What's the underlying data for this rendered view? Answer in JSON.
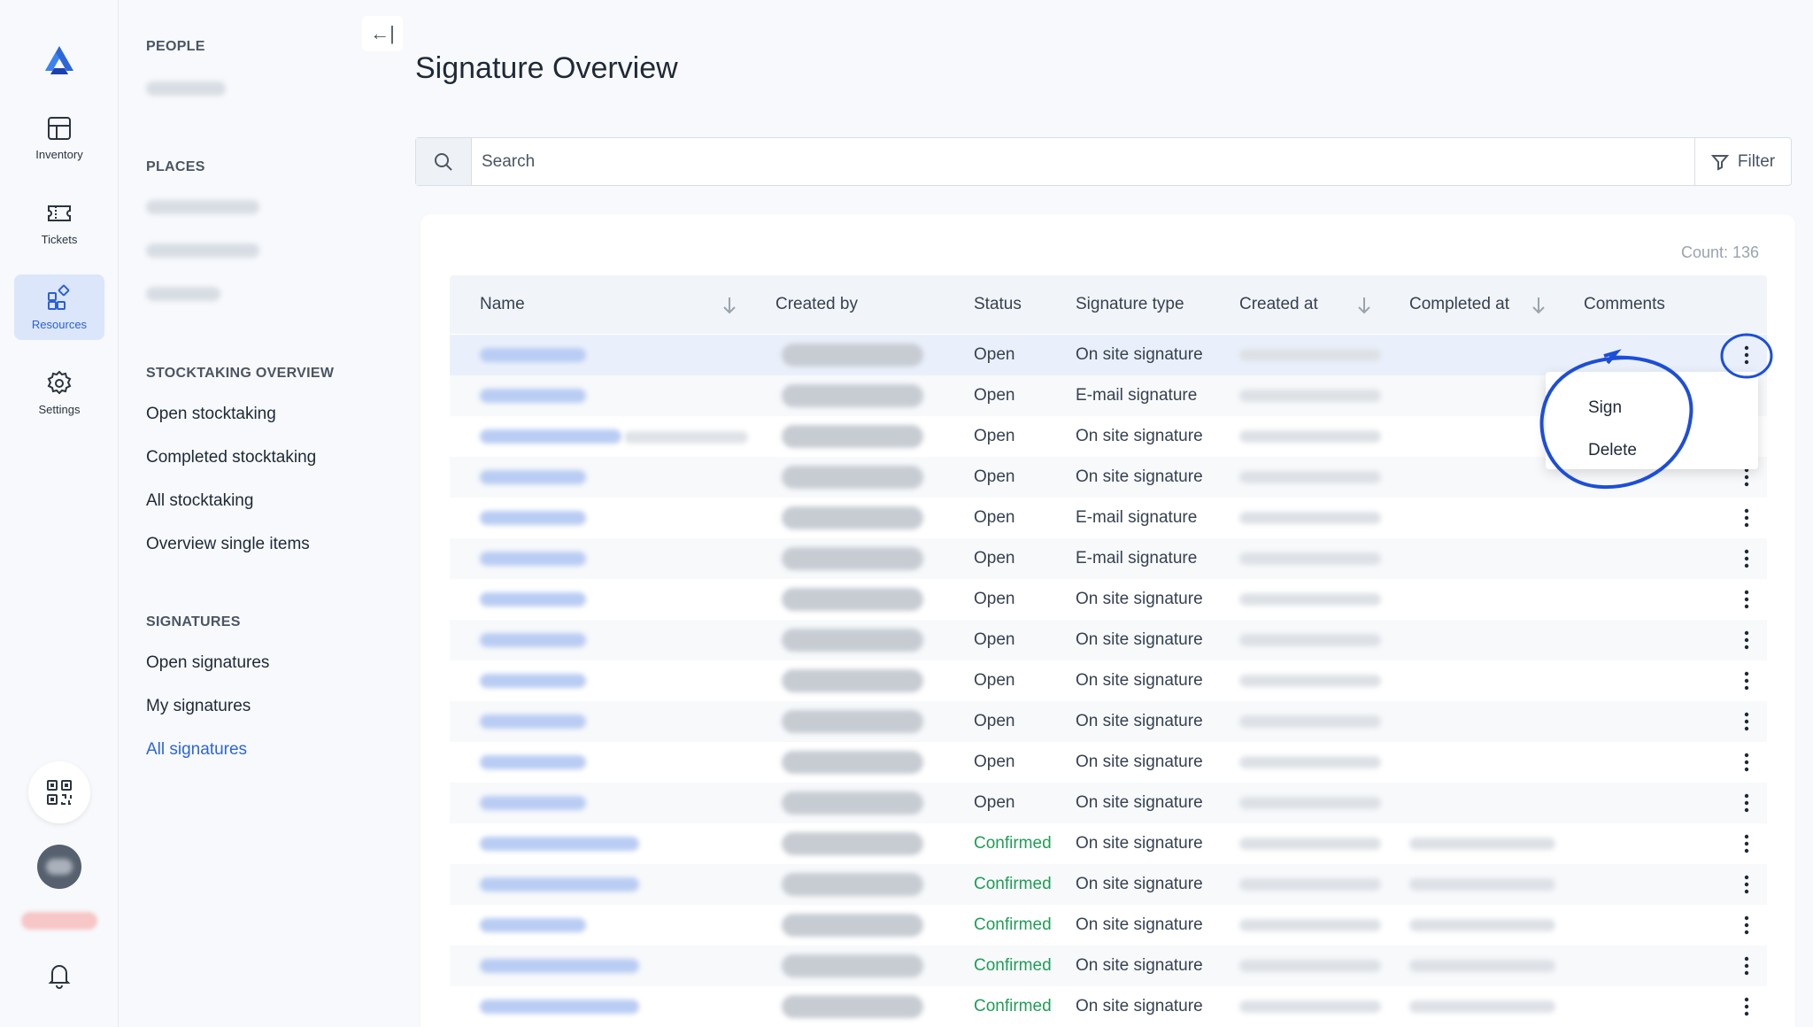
{
  "rail": {
    "items": [
      {
        "label": "Inventory",
        "icon": "inventory-icon"
      },
      {
        "label": "Tickets",
        "icon": "ticket-icon"
      },
      {
        "label": "Resources",
        "icon": "resources-icon",
        "active": true
      },
      {
        "label": "Settings",
        "icon": "gear-icon"
      }
    ]
  },
  "nav": {
    "collapse_glyph": "←|",
    "sections": {
      "people": "PEOPLE",
      "places": "PLACES",
      "stocktaking": "STOCKTAKING OVERVIEW",
      "signatures": "SIGNATURES"
    },
    "stocktaking_links": [
      "Open stocktaking",
      "Completed stocktaking",
      "All stocktaking",
      "Overview single items"
    ],
    "signature_links": [
      "Open signatures",
      "My signatures",
      "All signatures"
    ],
    "active_link": "All signatures"
  },
  "page": {
    "title": "Signature Overview",
    "search_placeholder": "Search",
    "filter_label": "Filter",
    "count": "Count: 136"
  },
  "table": {
    "headers": [
      "Name",
      "Created by",
      "Status",
      "Signature type",
      "Created at",
      "Completed at",
      "Comments"
    ],
    "rows": [
      {
        "status": "Open",
        "type": "On site signature"
      },
      {
        "status": "Open",
        "type": "E-mail signature"
      },
      {
        "status": "Open",
        "type": "On site signature"
      },
      {
        "status": "Open",
        "type": "On site signature"
      },
      {
        "status": "Open",
        "type": "E-mail signature"
      },
      {
        "status": "Open",
        "type": "E-mail signature"
      },
      {
        "status": "Open",
        "type": "On site signature"
      },
      {
        "status": "Open",
        "type": "On site signature"
      },
      {
        "status": "Open",
        "type": "On site signature"
      },
      {
        "status": "Open",
        "type": "On site signature"
      },
      {
        "status": "Open",
        "type": "On site signature"
      },
      {
        "status": "Open",
        "type": "On site signature"
      },
      {
        "status": "Confirmed",
        "type": "On site signature"
      },
      {
        "status": "Confirmed",
        "type": "On site signature"
      },
      {
        "status": "Confirmed",
        "type": "On site signature"
      },
      {
        "status": "Confirmed",
        "type": "On site signature"
      },
      {
        "status": "Confirmed",
        "type": "On site signature"
      }
    ]
  },
  "context_menu": {
    "items": [
      "Sign",
      "Delete"
    ]
  },
  "colors": {
    "accent": "#2c66d8",
    "confirmed": "#1f9d56",
    "annotation": "#1d4ed8"
  }
}
